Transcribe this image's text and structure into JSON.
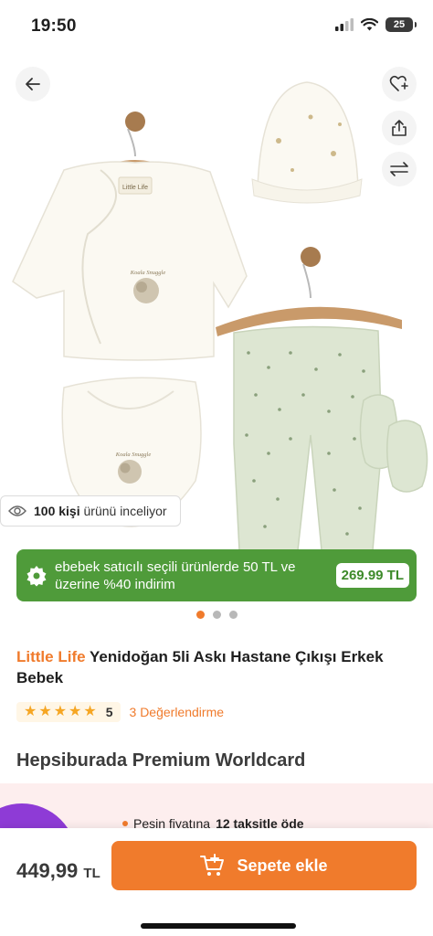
{
  "status": {
    "time": "19:50",
    "battery": "25"
  },
  "gallery": {
    "viewer_count": "100 kişi",
    "viewer_suffix": "ürünü inceliyor",
    "hang_tag_text": "Little Life",
    "print_text": "Koala Snuggle"
  },
  "promo": {
    "text": "ebebek satıcılı seçili ürünlerde 50 TL ve üzerine %40 indirim",
    "price": "269.99 TL"
  },
  "pagination": {
    "total": 3,
    "active": 1
  },
  "product": {
    "brand": "Little Life",
    "name": "Yenidoğan 5li Askı Hastane Çıkışı Erkek Bebek",
    "rating_value": "5",
    "rating_stars": 5,
    "reviews_link": "3 Değerlendirme"
  },
  "card": {
    "title": "Hepsiburada Premium Worldcard",
    "line_prefix": "Peşin fiyatına",
    "line_bold": "12 taksitle öde"
  },
  "bottom": {
    "price": "449,99",
    "currency": "TL",
    "add_label": "Sepete ekle"
  },
  "colors": {
    "accent": "#f07b2c",
    "promo_green": "#4f9b3a",
    "card_purple": "#8e3bd6"
  }
}
